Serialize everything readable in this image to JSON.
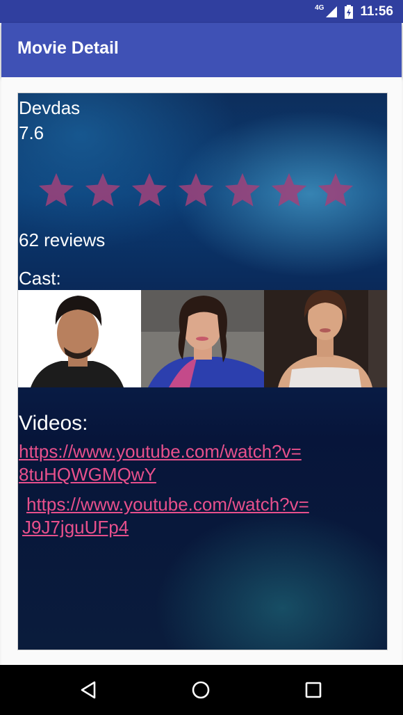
{
  "status_bar": {
    "network": "4G",
    "time": "11:56"
  },
  "app_bar": {
    "title": "Movie Detail",
    "color": "#3F51B5"
  },
  "movie": {
    "title": "Devdas",
    "rating": "7.6",
    "stars_total": 7,
    "reviews": "62 reviews",
    "cast_label": "Cast:",
    "cast": [
      {
        "photo": "actor-portrait"
      },
      {
        "photo": "actress-portrait"
      },
      {
        "photo": "actress-portrait"
      }
    ],
    "videos_label": "Videos:",
    "videos": [
      {
        "url_line1": "https://www.youtube.com/watch?v=",
        "url_line2": "8tuHQWGMQwY"
      },
      {
        "url_line1": "https://www.youtube.com/watch?v=",
        "url_line2": "J9J7jguUFp4"
      }
    ]
  },
  "colors": {
    "link": "#e8508c",
    "star": "#a0427a"
  },
  "nav": {
    "icons": [
      "back-icon",
      "home-icon",
      "recent-apps-icon"
    ]
  }
}
